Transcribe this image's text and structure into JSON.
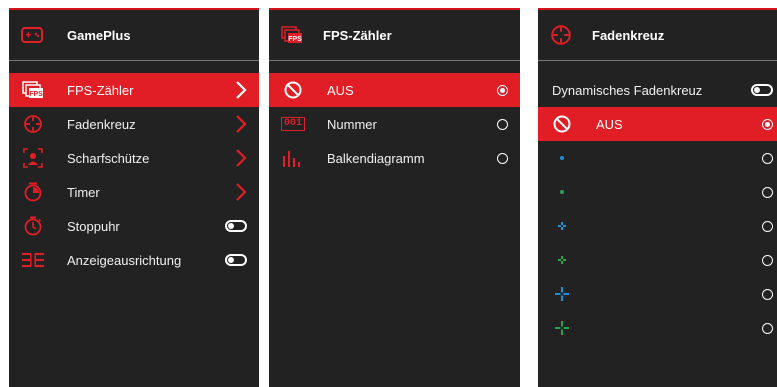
{
  "accent_color": "#e11d26",
  "panel_bg": "#222222",
  "gameplus": {
    "title": "GamePlus",
    "icon": "gamepad-icon",
    "items": [
      {
        "label": "FPS-Zähler",
        "icon": "fps-icon",
        "control": "chevron",
        "selected": true
      },
      {
        "label": "Fadenkreuz",
        "icon": "crosshair-icon",
        "control": "chevron"
      },
      {
        "label": "Scharfschütze",
        "icon": "sniper-icon",
        "control": "chevron"
      },
      {
        "label": "Timer",
        "icon": "timer-icon",
        "control": "chevron"
      },
      {
        "label": "Stoppuhr",
        "icon": "stopwatch-icon",
        "control": "toggle",
        "on": false
      },
      {
        "label": "Anzeigeausrichtung",
        "icon": "display-alignment-icon",
        "control": "toggle",
        "on": false
      }
    ]
  },
  "fps": {
    "title": "FPS-Zähler",
    "icon": "fps-icon",
    "options": [
      {
        "label": "AUS",
        "icon": "off-icon",
        "selected": true
      },
      {
        "label": "Nummer",
        "icon": "number-icon",
        "number_text": "001",
        "selected": false
      },
      {
        "label": "Balkendiagramm",
        "icon": "bar-graph-icon",
        "selected": false
      }
    ]
  },
  "crosshair": {
    "title": "Fadenkreuz",
    "icon": "crosshair-icon",
    "dynamic_label": "Dynamisches Fadenkreuz",
    "dynamic_on": false,
    "options": [
      {
        "label": "AUS",
        "icon": "off-icon",
        "selected": true
      },
      {
        "icon": "blue-dot-icon",
        "color": "#1e90d6"
      },
      {
        "icon": "green-dot-icon",
        "color": "#22a84a"
      },
      {
        "icon": "small-blue-cross-icon",
        "color": "#1e90d6"
      },
      {
        "icon": "small-green-cross-icon",
        "color": "#22a84a"
      },
      {
        "icon": "large-blue-cross-icon",
        "color": "#1e90d6"
      },
      {
        "icon": "large-green-cross-icon",
        "color": "#22a84a"
      }
    ]
  }
}
